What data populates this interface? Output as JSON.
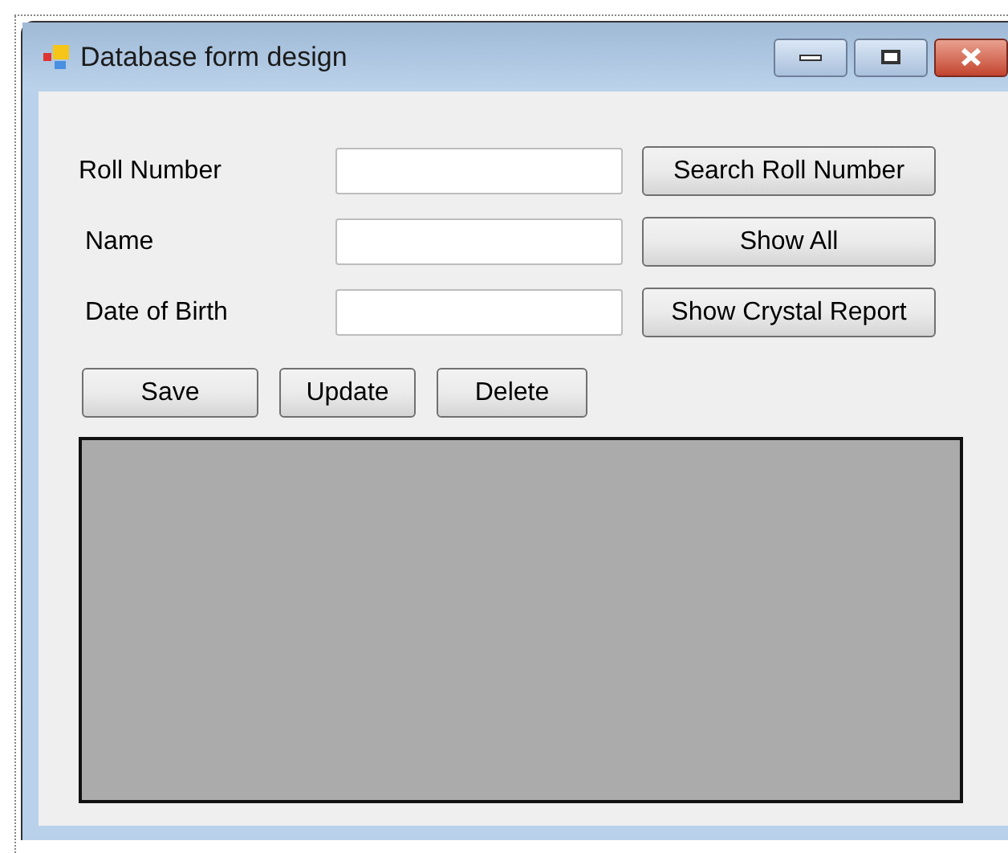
{
  "window": {
    "title": "Database form design"
  },
  "fields": [
    {
      "label": "Roll Number",
      "button": "Search Roll Number"
    },
    {
      "label": "Name",
      "button": "Show All"
    },
    {
      "label": "Date of Birth",
      "button": "Show Crystal Report"
    }
  ],
  "action_buttons": [
    "Save",
    "Update",
    "Delete"
  ]
}
